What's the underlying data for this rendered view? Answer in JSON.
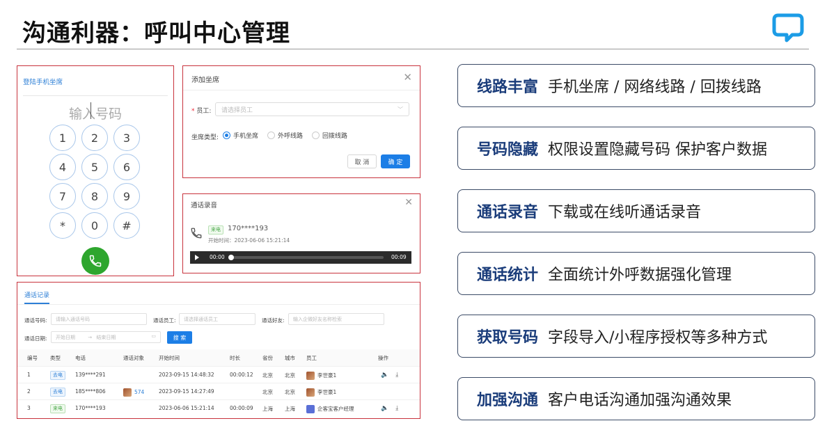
{
  "title": "沟通利器：呼叫中心管理",
  "brand_color": "#1c9ce6",
  "dialer": {
    "title": "登陆手机坐席",
    "placeholder": "输入号码",
    "keys": [
      "1",
      "2",
      "3",
      "4",
      "5",
      "6",
      "7",
      "8",
      "9",
      "*",
      "0",
      "#"
    ]
  },
  "add_seat": {
    "title": "添加坐席",
    "employee_label": "员工:",
    "employee_placeholder": "请选择员工",
    "type_label": "坐席类型:",
    "options": [
      "手机坐席",
      "外呼线路",
      "回拨线路"
    ],
    "selected_index": 0,
    "cancel": "取 消",
    "ok": "确 定"
  },
  "recording": {
    "title": "通话录音",
    "tag": "来电",
    "number": "170****193",
    "start_time": "开始时间：2023-06-06 15:21:14",
    "current": "00:00",
    "duration": "00:09"
  },
  "records": {
    "tab": "通话记录",
    "filters": {
      "number_label": "通话号码:",
      "number_placeholder": "请输入通话号码",
      "staff_label": "通话员工:",
      "staff_placeholder": "请选择通话员工",
      "friend_label": "通话好友:",
      "friend_placeholder": "输入企微好友名称检索",
      "date_label": "通话日期:",
      "start_placeholder": "开始日期",
      "arrow": "→",
      "end_placeholder": "结束日期",
      "search": "搜 索"
    },
    "columns": [
      "编号",
      "类型",
      "电话",
      "通话对象",
      "开始时间",
      "时长",
      "省份",
      "城市",
      "员工",
      "操作"
    ],
    "rows": [
      {
        "id": "1",
        "type": "去电",
        "phone": "139****291",
        "target": "",
        "start": "2023-09-15 14:48:32",
        "duration": "00:00:12",
        "province": "北京",
        "city": "北京",
        "staff": "李世豪1",
        "ops": [
          "🔈",
          "⤓"
        ]
      },
      {
        "id": "2",
        "type": "去电",
        "phone": "185****806",
        "target": "574",
        "start": "2023-09-15 14:27:49",
        "duration": "",
        "province": "北京",
        "city": "北京",
        "staff": "李世豪1",
        "ops": []
      },
      {
        "id": "3",
        "type": "来电",
        "phone": "170****193",
        "target": "",
        "start": "2023-06-06 15:21:14",
        "duration": "00:00:09",
        "province": "上海",
        "city": "上海",
        "staff": "企客宝客户经理",
        "ops": [
          "🔈",
          "⤓"
        ]
      }
    ]
  },
  "features": [
    {
      "name": "线路丰富",
      "desc": "手机坐席 / 网络线路 / 回拨线路"
    },
    {
      "name": "号码隐藏",
      "desc": "权限设置隐藏号码 保护客户数据"
    },
    {
      "name": "通话录音",
      "desc": "下载或在线听通话录音"
    },
    {
      "name": "通话统计",
      "desc": "全面统计外呼数据强化管理"
    },
    {
      "name": "获取号码",
      "desc": "字段导入/小程序授权等多种方式"
    },
    {
      "name": "加强沟通",
      "desc": "客户电话沟通加强沟通效果"
    }
  ]
}
